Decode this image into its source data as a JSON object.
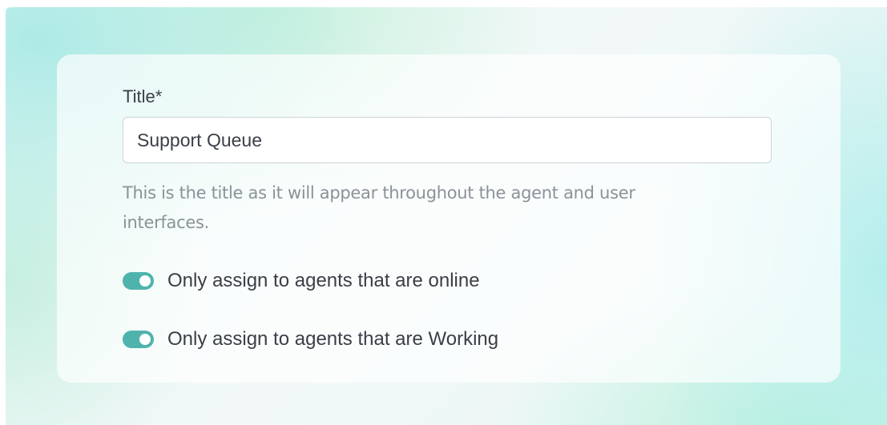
{
  "form": {
    "title_label": "Title*",
    "title_value": "Support Queue",
    "help_text": "This is the title as it will appear throughout the agent and user interfaces.",
    "toggles": [
      {
        "label": "Only assign to agents that are online",
        "checked": true
      },
      {
        "label": "Only assign to agents that are Working",
        "checked": true
      }
    ]
  },
  "colors": {
    "toggle_on": "#4fb3ad",
    "text": "#3a3f47",
    "help_text": "#8a9298"
  }
}
